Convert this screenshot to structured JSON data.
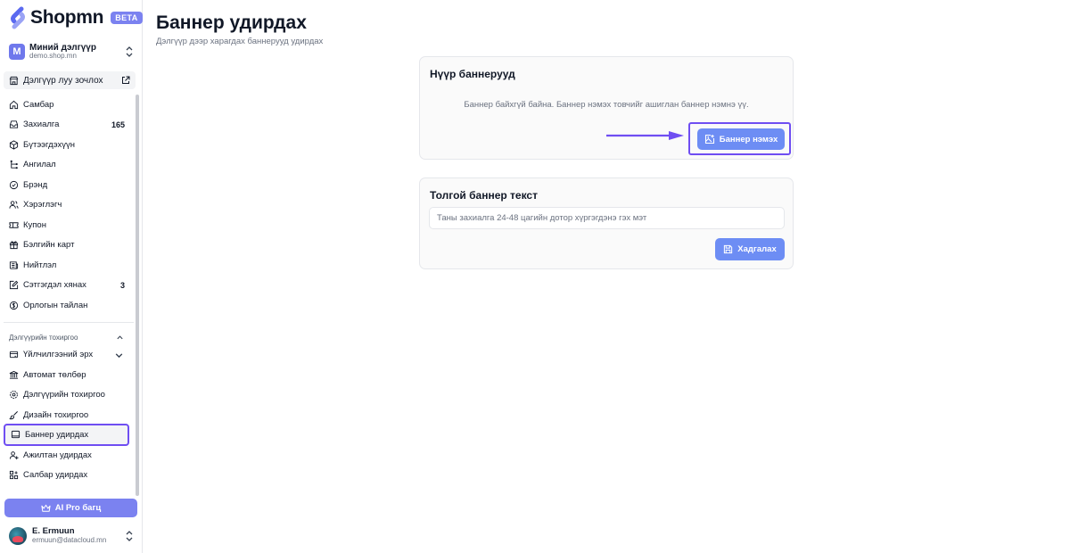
{
  "brand": {
    "logo_text": "Shopmn",
    "badge": "BETA"
  },
  "store": {
    "initial": "M",
    "name": "Миний дэлгүүр",
    "domain": "demo.shop.mn"
  },
  "visit_store": {
    "label": "Дэлгүүр луу зочлох"
  },
  "nav": {
    "dashboard": "Самбар",
    "orders": {
      "label": "Захиалга",
      "count": "165"
    },
    "products": "Бүтээгдэхүүн",
    "categories": "Ангилал",
    "brands": "Брэнд",
    "customers": "Хэрэглэгч",
    "coupons": "Купон",
    "gift_cards": "Бэлгийн карт",
    "posts": "Нийтлэл",
    "reviews": {
      "label": "Сэтгэгдэл хянах",
      "count": "3"
    },
    "expense_report": "Орлогын тайлан"
  },
  "settings_section": {
    "label": "Дэлгүүрийн тохиргоо",
    "items": {
      "subscription": "Үйлчилгээний эрх",
      "auto_payment": "Автомат төлбөр",
      "store_settings": "Дэлгүүрийн тохиргоо",
      "design_settings": "Дизайн тохиргоо",
      "banners": "Баннер удирдах",
      "staff": "Ажилтан удирдах",
      "branches": "Салбар удирдах"
    }
  },
  "ai_pro": {
    "label": "AI Pro багц"
  },
  "user": {
    "name": "E. Ermuun",
    "email": "ermuun@datacloud.mn"
  },
  "page": {
    "title": "Баннер удирдах",
    "subtitle": "Дэлгүүр дээр харагдах баннерууд удирдах"
  },
  "home_banners": {
    "title": "Нүүр баннерууд",
    "empty_text": "Баннер байхгүй байна. Баннер нэмэх товчийг ашиглан баннер нэмнэ үү.",
    "add_button": "Баннер нэмэх"
  },
  "header_text": {
    "title": "Толгой баннер текст",
    "placeholder": "Таны захиалга 24-48 цагийн дотор хүргэгдэнэ гэх мэт",
    "value": "",
    "save_button": "Хадгалах"
  },
  "colors": {
    "accent": "#6d8df4",
    "highlight": "#6f4ef2",
    "brand": "#7b82f0"
  }
}
